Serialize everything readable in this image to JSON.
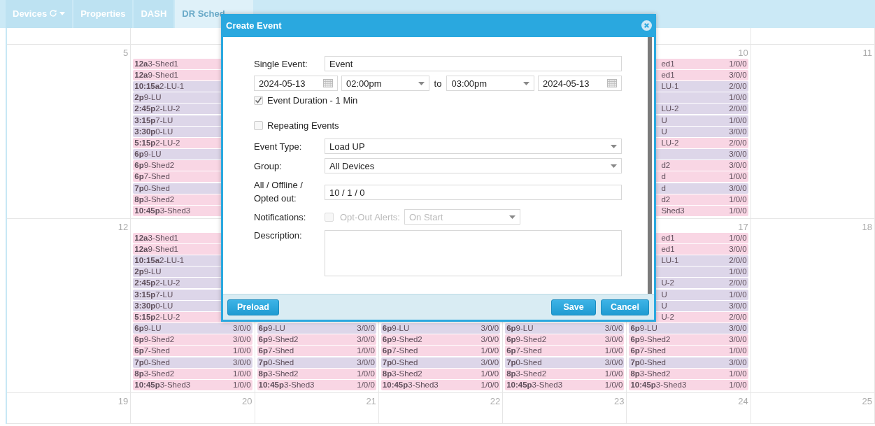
{
  "tabs": [
    {
      "label": "Devices",
      "kind": "menu",
      "selected": false
    },
    {
      "label": "Properties",
      "kind": "plain",
      "selected": false
    },
    {
      "label": "DASH",
      "kind": "plain",
      "selected": false
    },
    {
      "label": "DR Sched",
      "kind": "plain",
      "selected": true
    }
  ],
  "calendar": {
    "weeks": [
      {
        "days": [
          {
            "kind": "day",
            "date": "5"
          },
          {
            "kind": "day",
            "events": [
              {
                "time": "12a",
                "title": "3-Shed1",
                "color": "#f9d6e4"
              },
              {
                "time": "12a",
                "title": "9-Shed1",
                "color": "#f9d6e4"
              },
              {
                "time": "10:15a",
                "title": "2-LU-1",
                "color": "#ddd6e9"
              },
              {
                "time": "2p",
                "title": "9-LU",
                "color": "#ddd6e9"
              },
              {
                "time": "2:45p",
                "title": "2-LU-2",
                "color": "#ddd6e9"
              },
              {
                "time": "3:15p",
                "title": "7-LU",
                "color": "#ddd6e9"
              },
              {
                "time": "3:30p",
                "title": "0-LU",
                "color": "#ddd6e9"
              },
              {
                "time": "5:15p",
                "title": "2-LU-2",
                "color": "#f9d6e4"
              },
              {
                "time": "6p",
                "title": "9-LU",
                "color": "#ddd6e9"
              },
              {
                "time": "6p",
                "title": "9-Shed2",
                "color": "#f9d6e4"
              },
              {
                "time": "6p",
                "title": "7-Shed",
                "color": "#f9d6e4"
              },
              {
                "time": "7p",
                "title": "0-Shed",
                "color": "#ddd6e9"
              },
              {
                "time": "8p",
                "title": "3-Shed2",
                "color": "#f9d6e4"
              },
              {
                "time": "10:45p",
                "title": "3-Shed3",
                "color": "#f9d6e4"
              }
            ]
          },
          {
            "kind": "covered"
          },
          {
            "kind": "covered"
          },
          {
            "kind": "covered"
          },
          {
            "kind": "day",
            "date": "10",
            "events": [
              {
                "title": "ed1",
                "count": "1/0/0",
                "color": "#f9d6e4"
              },
              {
                "title": "ed1",
                "count": "3/0/0",
                "color": "#f9d6e4"
              },
              {
                "title": "LU-1",
                "count": "2/0/0",
                "color": "#ddd6e9"
              },
              {
                "count": "1/0/0",
                "color": "#ddd6e9"
              },
              {
                "title": "LU-2",
                "count": "2/0/0",
                "color": "#ddd6e9"
              },
              {
                "title": "U",
                "count": "1/0/0",
                "color": "#ddd6e9"
              },
              {
                "title": "U",
                "count": "3/0/0",
                "color": "#ddd6e9"
              },
              {
                "title": "LU-2",
                "count": "2/0/0",
                "color": "#f9d6e4"
              },
              {
                "count": "3/0/0",
                "color": "#ddd6e9"
              },
              {
                "title": "d2",
                "count": "3/0/0",
                "color": "#f9d6e4"
              },
              {
                "title": "d",
                "count": "1/0/0",
                "color": "#f9d6e4"
              },
              {
                "title": "d",
                "count": "3/0/0",
                "color": "#ddd6e9"
              },
              {
                "title": "d2",
                "count": "1/0/0",
                "color": "#f9d6e4"
              },
              {
                "title": "Shed3",
                "count": "1/0/0",
                "color": "#f9d6e4"
              }
            ]
          },
          {
            "kind": "day",
            "date": "11"
          }
        ]
      },
      {
        "days": [
          {
            "kind": "day",
            "date": "12"
          },
          {
            "kind": "day",
            "events": [
              {
                "time": "12a",
                "title": "3-Shed1",
                "color": "#f9d6e4"
              },
              {
                "time": "12a",
                "title": "9-Shed1",
                "color": "#f9d6e4"
              },
              {
                "time": "10:15a",
                "title": "2-LU-1",
                "color": "#ddd6e9"
              },
              {
                "time": "2p",
                "title": "9-LU",
                "color": "#ddd6e9"
              },
              {
                "time": "2:45p",
                "title": "2-LU-2",
                "color": "#ddd6e9"
              },
              {
                "time": "3:15p",
                "title": "7-LU",
                "color": "#ddd6e9"
              },
              {
                "time": "3:30p",
                "title": "0-LU",
                "color": "#ddd6e9"
              },
              {
                "time": "5:15p",
                "title": "2-LU-2",
                "color": "#f9d6e4"
              },
              {
                "time": "6p",
                "title": "9-LU",
                "count": "3/0/0",
                "color": "#ddd6e9"
              },
              {
                "time": "6p",
                "title": "9-Shed2",
                "count": "3/0/0",
                "color": "#f9d6e4"
              },
              {
                "time": "6p",
                "title": "7-Shed",
                "count": "1/0/0",
                "color": "#f9d6e4"
              },
              {
                "time": "7p",
                "title": "0-Shed",
                "count": "3/0/0",
                "color": "#ddd6e9"
              },
              {
                "time": "8p",
                "title": "3-Shed2",
                "count": "1/0/0",
                "color": "#f9d6e4"
              },
              {
                "time": "10:45p",
                "title": "3-Shed3",
                "count": "1/0/0",
                "color": "#f9d6e4"
              }
            ]
          },
          {
            "kind": "day",
            "events": [
              {
                "time": "6p",
                "title": "9-LU",
                "count": "3/0/0",
                "color": "#ddd6e9"
              },
              {
                "time": "6p",
                "title": "9-Shed2",
                "count": "3/0/0",
                "color": "#f9d6e4"
              },
              {
                "time": "6p",
                "title": "7-Shed",
                "count": "1/0/0",
                "color": "#f9d6e4"
              },
              {
                "time": "7p",
                "title": "0-Shed",
                "count": "3/0/0",
                "color": "#ddd6e9"
              },
              {
                "time": "8p",
                "title": "3-Shed2",
                "count": "1/0/0",
                "color": "#f9d6e4"
              },
              {
                "time": "10:45p",
                "title": "3-Shed3",
                "count": "1/0/0",
                "color": "#f9d6e4"
              }
            ]
          },
          {
            "kind": "day",
            "events": [
              {
                "time": "6p",
                "title": "9-LU",
                "count": "3/0/0",
                "color": "#ddd6e9"
              },
              {
                "time": "6p",
                "title": "9-Shed2",
                "count": "3/0/0",
                "color": "#f9d6e4"
              },
              {
                "time": "6p",
                "title": "7-Shed",
                "count": "1/0/0",
                "color": "#f9d6e4"
              },
              {
                "time": "7p",
                "title": "0-Shed",
                "count": "3/0/0",
                "color": "#ddd6e9"
              },
              {
                "time": "8p",
                "title": "3-Shed2",
                "count": "1/0/0",
                "color": "#f9d6e4"
              },
              {
                "time": "10:45p",
                "title": "3-Shed3",
                "count": "1/0/0",
                "color": "#f9d6e4"
              }
            ]
          },
          {
            "kind": "day",
            "events": [
              {
                "time": "6p",
                "title": "9-LU",
                "count": "3/0/0",
                "color": "#ddd6e9"
              },
              {
                "time": "6p",
                "title": "9-Shed2",
                "count": "3/0/0",
                "color": "#f9d6e4"
              },
              {
                "time": "6p",
                "title": "7-Shed",
                "count": "1/0/0",
                "color": "#f9d6e4"
              },
              {
                "time": "7p",
                "title": "0-Shed",
                "count": "3/0/0",
                "color": "#ddd6e9"
              },
              {
                "time": "8p",
                "title": "3-Shed2",
                "count": "1/0/0",
                "color": "#f9d6e4"
              },
              {
                "time": "10:45p",
                "title": "3-Shed3",
                "count": "1/0/0",
                "color": "#f9d6e4"
              }
            ]
          },
          {
            "kind": "day",
            "date": "17",
            "events": [
              {
                "title": "ed1",
                "count": "1/0/0",
                "color": "#f9d6e4"
              },
              {
                "title": "ed1",
                "count": "3/0/0",
                "color": "#f9d6e4"
              },
              {
                "title": "LU-1",
                "count": "2/0/0",
                "color": "#ddd6e9"
              },
              {
                "count": "1/0/0",
                "color": "#ddd6e9"
              },
              {
                "title": "U-2",
                "count": "2/0/0",
                "color": "#ddd6e9"
              },
              {
                "title": "U",
                "count": "1/0/0",
                "color": "#ddd6e9"
              },
              {
                "title": "U",
                "count": "3/0/0",
                "color": "#ddd6e9"
              },
              {
                "title": "U-2",
                "count": "2/0/0",
                "color": "#f9d6e4"
              },
              {
                "time": "6p",
                "title": "9-LU",
                "count": "3/0/0",
                "color": "#ddd6e9"
              },
              {
                "time": "6p",
                "title": "9-Shed2",
                "count": "3/0/0",
                "color": "#f9d6e4"
              },
              {
                "time": "6p",
                "title": "7-Shed",
                "count": "1/0/0",
                "color": "#f9d6e4"
              },
              {
                "time": "7p",
                "title": "0-Shed",
                "count": "3/0/0",
                "color": "#ddd6e9"
              },
              {
                "time": "8p",
                "title": "3-Shed2",
                "count": "1/0/0",
                "color": "#f9d6e4"
              },
              {
                "time": "10:45p",
                "title": "3-Shed3",
                "count": "1/0/0",
                "color": "#f9d6e4"
              }
            ]
          },
          {
            "kind": "day",
            "date": "18"
          }
        ]
      },
      {
        "days": [
          {
            "kind": "day",
            "date": "19"
          },
          {
            "kind": "day",
            "date": "20"
          },
          {
            "kind": "day",
            "date": "21"
          },
          {
            "kind": "day",
            "date": "22"
          },
          {
            "kind": "day",
            "date": "23"
          },
          {
            "kind": "day",
            "date": "24"
          },
          {
            "kind": "day",
            "date": "25"
          }
        ]
      }
    ]
  },
  "dialog": {
    "title": "Create Event",
    "single_event": {
      "label": "Single Event:",
      "value": "Event"
    },
    "start_date": "2024-05-13",
    "start_time": "02:00pm",
    "to": "to",
    "end_time": "03:00pm",
    "end_date": "2024-05-13",
    "duration": {
      "label": "Event Duration - 1 Min",
      "checked": true
    },
    "repeating": {
      "label": "Repeating Events",
      "checked": false
    },
    "event_type": {
      "label": "Event Type:",
      "value": "Load UP"
    },
    "group": {
      "label": "Group:",
      "value": "All Devices"
    },
    "counts": {
      "label": "All / Offline / Opted out:",
      "value": "10 / 1 / 0"
    },
    "notifications": {
      "label": "Notifications:",
      "checkbox_label": "Opt-Out Alerts:",
      "checked": false,
      "disabled": true,
      "value": "On Start"
    },
    "description": {
      "label": "Description:"
    },
    "left_buttons": [
      "Preload"
    ],
    "right_buttons": [
      "Save",
      "Cancel"
    ]
  }
}
